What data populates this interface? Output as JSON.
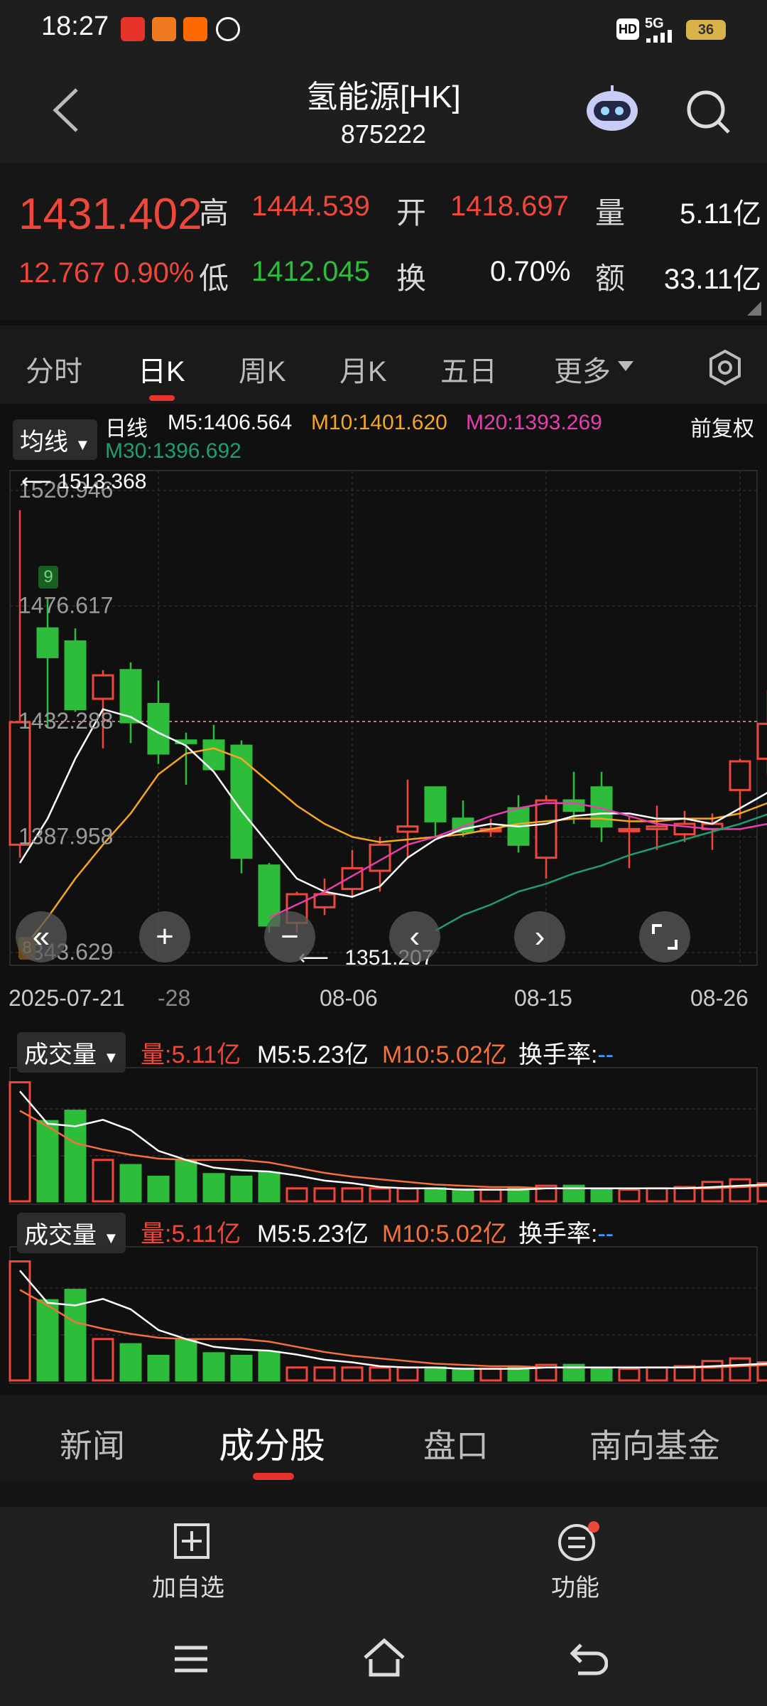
{
  "status_bar": {
    "time": "18:27",
    "network": "5G",
    "hd": "HD",
    "battery": "36"
  },
  "header": {
    "title": "氢能源[HK]",
    "code": "875222"
  },
  "quote": {
    "price": "1431.402",
    "change": "12.767",
    "change_pct": "0.90%",
    "high_label": "高",
    "high": "1444.539",
    "low_label": "低",
    "low": "1412.045",
    "open_label": "开",
    "open": "1418.697",
    "turnover_label": "换",
    "turnover_rate": "0.70%",
    "volume_label": "量",
    "volume": "5.11亿",
    "amount_label": "额",
    "amount": "33.11亿"
  },
  "tabs": [
    "分时",
    "日K",
    "周K",
    "月K",
    "五日",
    "更多"
  ],
  "active_tab": "日K",
  "chart_controls": {
    "ma_dropdown": "均线",
    "period_label": "日线",
    "ma5": "M5:1406.564",
    "ma10": "M10:1401.620",
    "ma20": "M20:1393.269",
    "ma30": "M30:1396.692",
    "adjust": "前复权",
    "max_marker": "1513.368",
    "min_marker": "1351.207",
    "badge_top": "9",
    "badge_bottom": "8"
  },
  "colors": {
    "up": "#f0473b",
    "down": "#2ebd3a",
    "ma5": "#ffffff",
    "ma10": "#f5a623",
    "ma20": "#e53fb0",
    "ma30": "#1f9e72",
    "accent": "#e8332a"
  },
  "chart_data": {
    "type": "candlestick",
    "y_ticks": [
      "1520.946",
      "1476.617",
      "1432.288",
      "1387.958",
      "1343.629"
    ],
    "x_ticks": [
      "2025-07-21",
      "-28",
      "08-06",
      "08-15",
      "08-26"
    ],
    "ylim": [
      1343.629,
      1520.946
    ],
    "current_price": 1432.288,
    "candles": [
      {
        "o": 1385,
        "h": 1513.4,
        "l": 1380,
        "c": 1432
      },
      {
        "o": 1468,
        "h": 1480,
        "l": 1430,
        "c": 1457
      },
      {
        "o": 1463,
        "h": 1468,
        "l": 1436,
        "c": 1437
      },
      {
        "o": 1441,
        "h": 1452,
        "l": 1422,
        "c": 1450
      },
      {
        "o": 1452,
        "h": 1455,
        "l": 1424,
        "c": 1432
      },
      {
        "o": 1439,
        "h": 1448,
        "l": 1416,
        "c": 1420
      },
      {
        "o": 1425,
        "h": 1428,
        "l": 1408,
        "c": 1424
      },
      {
        "o": 1425,
        "h": 1431,
        "l": 1414,
        "c": 1414
      },
      {
        "o": 1423,
        "h": 1425,
        "l": 1374,
        "c": 1380
      },
      {
        "o": 1377,
        "h": 1378,
        "l": 1351.2,
        "c": 1354
      },
      {
        "o": 1355,
        "h": 1367,
        "l": 1351.2,
        "c": 1366
      },
      {
        "o": 1361,
        "h": 1372,
        "l": 1358,
        "c": 1366
      },
      {
        "o": 1368,
        "h": 1383,
        "l": 1365,
        "c": 1376
      },
      {
        "o": 1375,
        "h": 1388,
        "l": 1367,
        "c": 1385
      },
      {
        "o": 1390,
        "h": 1410,
        "l": 1380,
        "c": 1392
      },
      {
        "o": 1407,
        "h": 1407,
        "l": 1388,
        "c": 1394
      },
      {
        "o": 1395,
        "h": 1402,
        "l": 1388,
        "c": 1390
      },
      {
        "o": 1391,
        "h": 1395,
        "l": 1388,
        "c": 1391
      },
      {
        "o": 1399,
        "h": 1404,
        "l": 1382,
        "c": 1385
      },
      {
        "o": 1380,
        "h": 1404,
        "l": 1372,
        "c": 1402
      },
      {
        "o": 1402,
        "h": 1413,
        "l": 1393,
        "c": 1398
      },
      {
        "o": 1407,
        "h": 1413,
        "l": 1386,
        "c": 1392
      },
      {
        "o": 1391,
        "h": 1396,
        "l": 1376,
        "c": 1391
      },
      {
        "o": 1391,
        "h": 1400,
        "l": 1383,
        "c": 1392
      },
      {
        "o": 1389,
        "h": 1398,
        "l": 1386,
        "c": 1393
      },
      {
        "o": 1391,
        "h": 1397,
        "l": 1383,
        "c": 1393
      },
      {
        "o": 1406,
        "h": 1418,
        "l": 1395,
        "c": 1417
      },
      {
        "o": 1418,
        "h": 1444.5,
        "l": 1412,
        "c": 1431.4
      }
    ],
    "ma5": [
      1378,
      1395,
      1418,
      1437,
      1434,
      1428,
      1423,
      1413,
      1398,
      1385,
      1372,
      1367,
      1365,
      1369,
      1380,
      1387,
      1391,
      1393,
      1392,
      1393,
      1396,
      1397,
      1397,
      1395,
      1395,
      1393,
      1399,
      1405
    ],
    "ma10": [
      1343.6,
      1357,
      1372,
      1385,
      1397,
      1412,
      1420,
      1422,
      1418,
      1409,
      1400,
      1393,
      1388,
      1386,
      1387,
      1388,
      1389,
      1391,
      1393,
      1394,
      1395,
      1395,
      1394,
      1394,
      1395,
      1395,
      1397,
      1401
    ],
    "ma20_start_index": 9,
    "ma20": [
      1357,
      1362,
      1367,
      1373,
      1379,
      1385,
      1388,
      1392,
      1396,
      1399,
      1401,
      1401,
      1399,
      1396,
      1393,
      1392,
      1391,
      1391,
      1393
    ],
    "ma30_start_index": 15,
    "ma30": [
      1352,
      1358,
      1362,
      1367,
      1370,
      1374,
      1377,
      1381,
      1384,
      1387,
      1390,
      1393,
      1396.7
    ],
    "volume_panel": {
      "label": "成交量",
      "vol": "量:5.11亿",
      "m5": "M5:5.23亿",
      "m10": "M10:5.02亿",
      "turnover": "换手率:",
      "turnover_value": "--",
      "bars": [
        92,
        62,
        70,
        32,
        28,
        19,
        31,
        21,
        19,
        22,
        10,
        10,
        10,
        10,
        10,
        10,
        9,
        9,
        10,
        12,
        12,
        9,
        9,
        10,
        11,
        15,
        17,
        14
      ],
      "ma5": [
        85,
        60,
        58,
        63,
        55,
        39,
        32,
        26,
        24,
        23,
        20,
        16,
        14,
        11,
        10,
        10,
        9,
        9,
        9,
        10,
        10,
        10,
        10,
        10,
        10,
        11,
        12,
        13
      ],
      "ma10": [
        70,
        58,
        45,
        40,
        36,
        33,
        32,
        32,
        32,
        30,
        26,
        22,
        19,
        17,
        15,
        13,
        12,
        11,
        11,
        10,
        10,
        10,
        10,
        10,
        10,
        10,
        11,
        12
      ],
      "vmax": 100
    }
  },
  "bottom_tabs": [
    "新闻",
    "成分股",
    "盘口",
    "南向基金"
  ],
  "active_bottom_tab": "成分股",
  "toolbar": {
    "add_watchlist": "加自选",
    "functions": "功能"
  }
}
